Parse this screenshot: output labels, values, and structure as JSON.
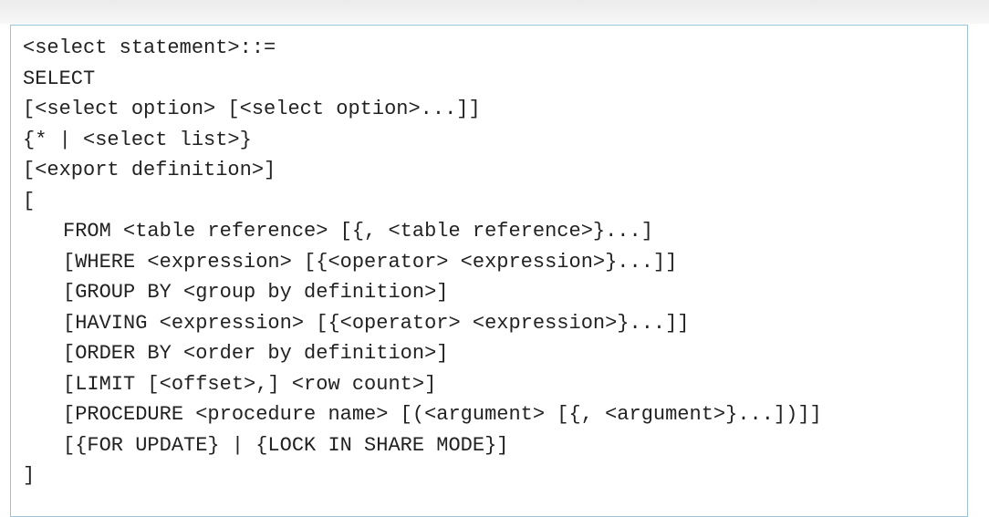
{
  "syntax": {
    "lines": [
      "<select statement>::=",
      "SELECT",
      "[<select option> [<select option>...]]",
      "{* | <select list>}",
      "[<export definition>]",
      "[",
      "FROM <table reference> [{, <table reference>}...]",
      "[WHERE <expression> [{<operator> <expression>}...]]",
      "[GROUP BY <group by definition>]",
      "[HAVING <expression> [{<operator> <expression>}...]]",
      "[ORDER BY <order by definition>]",
      "[LIMIT [<offset>,] <row count>]",
      "[PROCEDURE <procedure name> [(<argument> [{, <argument>}...])]]",
      "[{FOR UPDATE} | {LOCK IN SHARE MODE}]",
      "]"
    ]
  }
}
